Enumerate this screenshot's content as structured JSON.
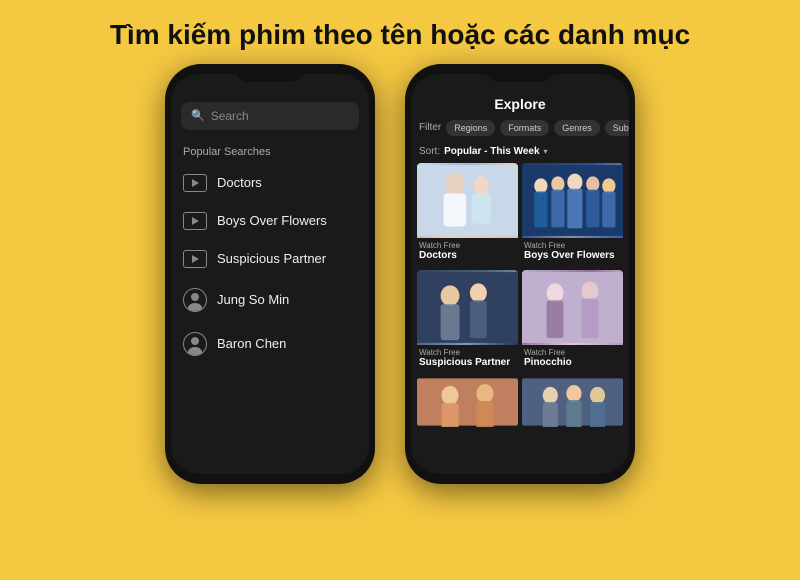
{
  "headline": "Tìm kiếm phim theo tên hoặc các danh mục",
  "left_phone": {
    "search_placeholder": "Search",
    "popular_label": "Popular Searches",
    "items": [
      {
        "type": "video",
        "text": "Doctors"
      },
      {
        "type": "video",
        "text": "Boys Over Flowers"
      },
      {
        "type": "video",
        "text": "Suspicious Partner"
      },
      {
        "type": "person",
        "text": "Jung So Min"
      },
      {
        "type": "person",
        "text": "Baron Chen"
      }
    ]
  },
  "right_phone": {
    "header": "Explore",
    "filter_label": "Filter",
    "filter_pills": [
      "Regions",
      "Formats",
      "Genres",
      "Subt"
    ],
    "sort_prefix": "Sort:",
    "sort_value": "Popular - This Week",
    "shows": [
      {
        "watch_free": "Watch Free",
        "title": "Doctors",
        "thumb_class": "thumb-doctors"
      },
      {
        "watch_free": "Watch Free",
        "title": "Boys Over Flowers",
        "thumb_class": "thumb-boys"
      },
      {
        "watch_free": "Watch Free",
        "title": "Suspicious Partner",
        "thumb_class": "thumb-suspicious"
      },
      {
        "watch_free": "Watch Free",
        "title": "Pinocchio",
        "thumb_class": "thumb-pinocchio"
      }
    ]
  }
}
